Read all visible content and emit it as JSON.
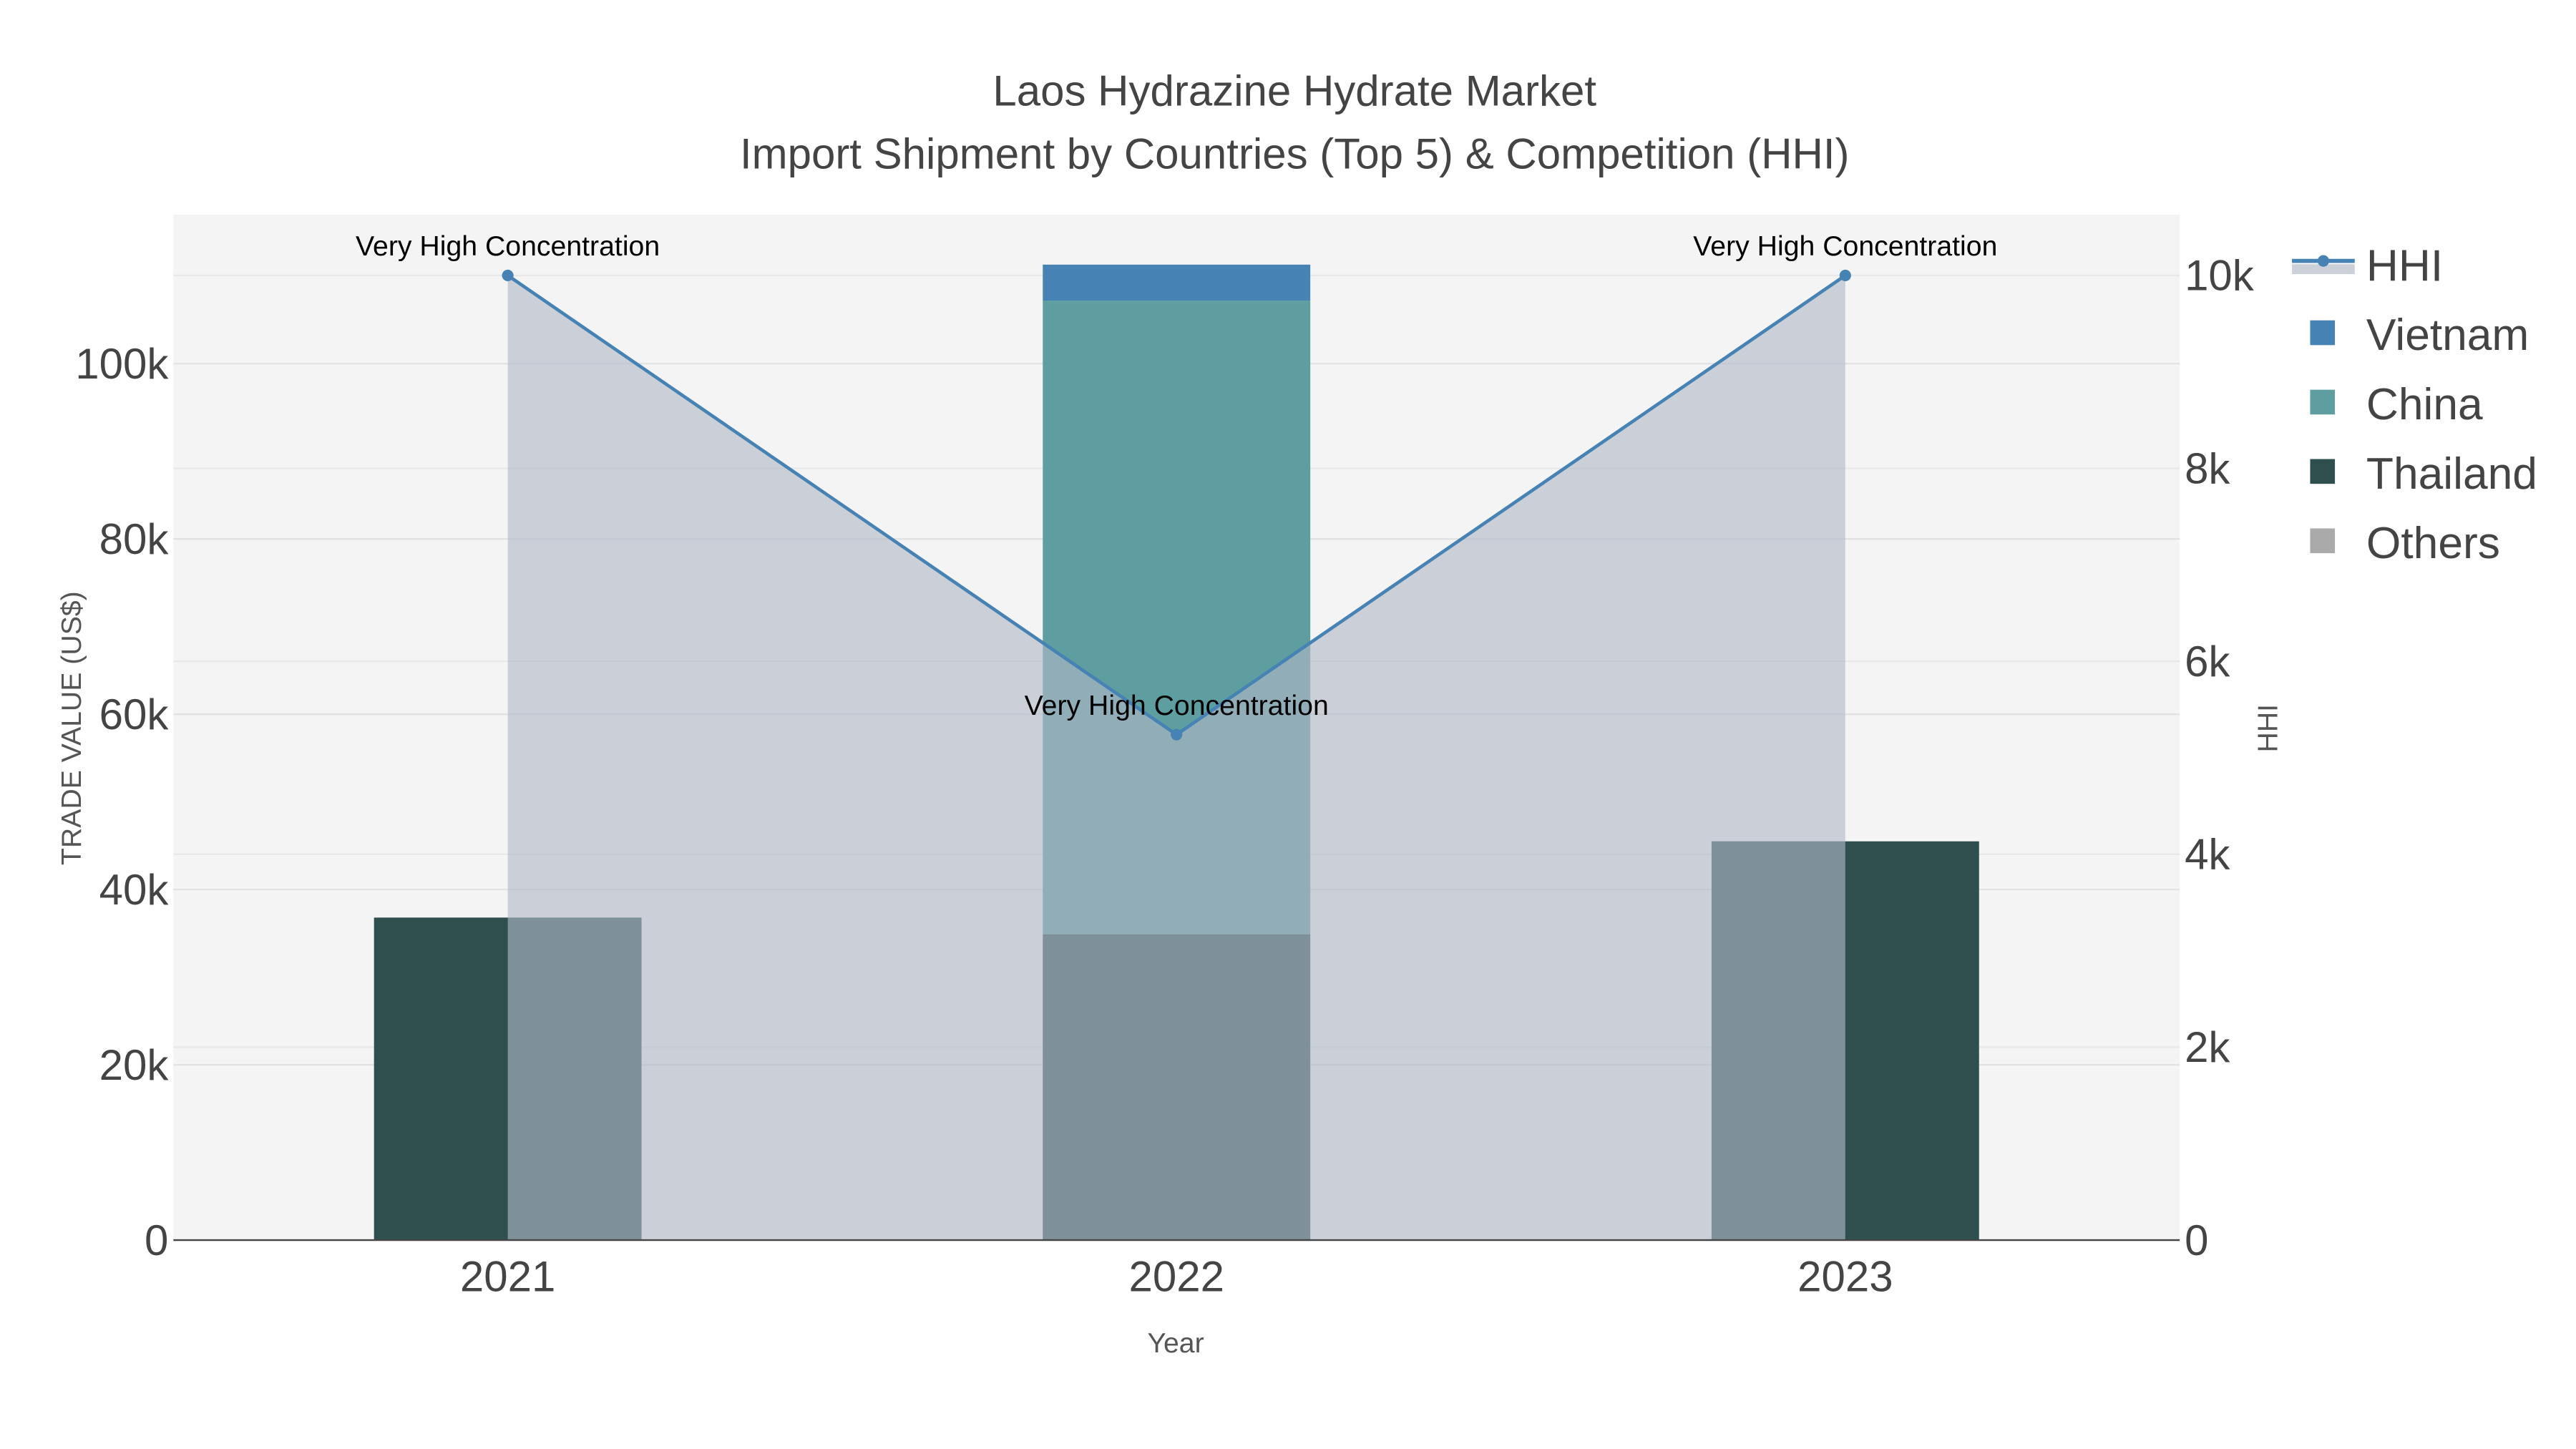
{
  "chart_data": {
    "type": "bar",
    "title": "Laos Hydrazine Hydrate Market",
    "subtitle": "Import Shipment by Countries (Top 5) & Competition (HHI)",
    "xlabel": "Year",
    "ylabel": "TRADE VALUE (US$)",
    "y2label": "HHI",
    "categories": [
      "2021",
      "2022",
      "2023"
    ],
    "ylim": [
      0,
      117000
    ],
    "y2lim": [
      0,
      10630
    ],
    "yticks": [
      0,
      20000,
      40000,
      60000,
      80000,
      100000
    ],
    "ytick_labels": [
      "0",
      "20k",
      "40k",
      "60k",
      "80k",
      "100k"
    ],
    "y2ticks": [
      0,
      2000,
      4000,
      6000,
      8000,
      10000
    ],
    "y2tick_labels": [
      "0",
      "2k",
      "4k",
      "6k",
      "8k",
      "10k"
    ],
    "barmode": "stack",
    "grid": true,
    "legend_position": "right",
    "series": [
      {
        "name": "Thailand",
        "color": "#2f4f4f",
        "values": [
          36800,
          34900,
          45500
        ]
      },
      {
        "name": "China",
        "color": "#5f9ea0",
        "values": [
          0,
          72300,
          0
        ]
      },
      {
        "name": "Vietnam",
        "color": "#4682b4",
        "values": [
          0,
          4100,
          0
        ]
      },
      {
        "name": "Others",
        "color": "#aaaaaa",
        "values": [
          0,
          0,
          0
        ]
      }
    ],
    "hhi": {
      "name": "HHI",
      "color": "#4682b4",
      "fill": "rgba(176,184,198,0.62)",
      "values": [
        10000,
        5240,
        10000
      ],
      "annotations": [
        "Very High Concentration",
        "Very High Concentration",
        "Very High Concentration"
      ]
    },
    "legend": [
      "HHI",
      "Vietnam",
      "China",
      "Thailand",
      "Others"
    ]
  }
}
